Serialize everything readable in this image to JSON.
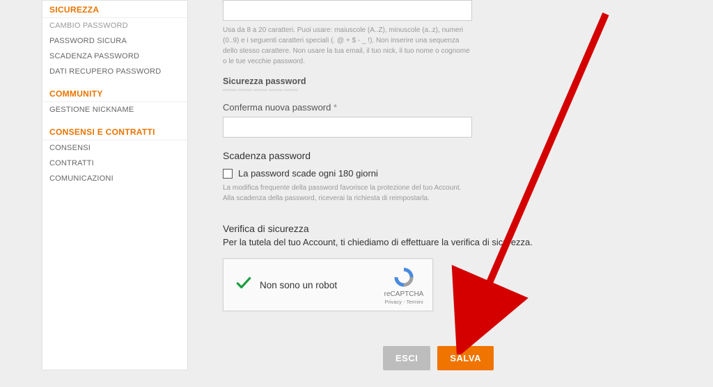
{
  "sidebar": {
    "sections": [
      {
        "header": "SICUREZZA",
        "items": [
          "CAMBIO PASSWORD",
          "PASSWORD SICURA",
          "SCADENZA PASSWORD",
          "DATI RECUPERO PASSWORD"
        ]
      },
      {
        "header": "COMMUNITY",
        "items": [
          "GESTIONE NICKNAME"
        ]
      },
      {
        "header": "CONSENSI E CONTRATTI",
        "items": [
          "CONSENSI",
          "CONTRATTI",
          "COMUNICAZIONI"
        ]
      }
    ]
  },
  "form": {
    "password_hint": "Usa da 8 a 20 caratteri. Puoi usare: maiuscole (A..Z), minuscole (a..z), numeri (0..9) e i seguenti caratteri speciali (. @ + $ - _ !). Non inserire una sequenza dello stesso carattere. Non usare la tua email, il tuo nick, il tuo nome o cognome o le tue vecchie password.",
    "strength_label": "Sicurezza password",
    "confirm_label": "Conferma nuova password",
    "asterisk": "*",
    "expiry_heading": "Scadenza password",
    "expiry_checkbox_label": "La password scade ogni 180 giorni",
    "expiry_hint": "La modifica frequente della password favorisce la protezione del tuo Account.\nAlla scadenza della password, riceverai la richiesta di reimpostarla.",
    "verify_heading": "Verifica di sicurezza",
    "verify_text": "Per la tutela del tuo Account, ti chiediamo di effettuare la verifica di sicurezza.",
    "recaptcha_label": "Non sono un robot",
    "recaptcha_brand": "reCAPTCHA",
    "recaptcha_links": "Privacy - Termini",
    "btn_cancel": "ESCI",
    "btn_save": "SALVA"
  }
}
